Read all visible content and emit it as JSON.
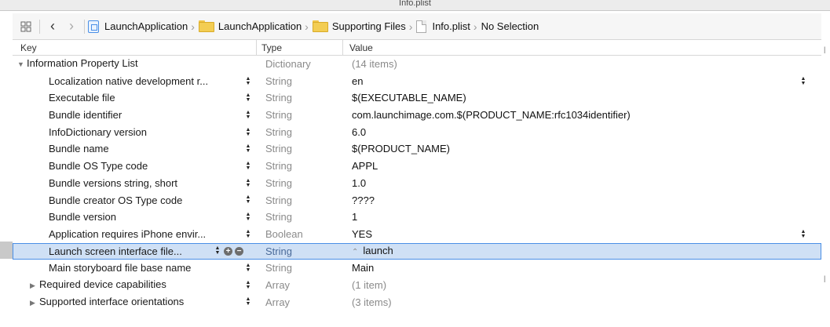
{
  "window": {
    "title": "Info.plist"
  },
  "jumpbar": {
    "crumbs": [
      {
        "label": "LaunchApplication",
        "icon": "project-icon"
      },
      {
        "label": "LaunchApplication",
        "icon": "folder-icon"
      },
      {
        "label": "Supporting Files",
        "icon": "folder-icon"
      },
      {
        "label": "Info.plist",
        "icon": "plist-file-icon"
      },
      {
        "label": "No Selection",
        "icon": ""
      }
    ]
  },
  "table": {
    "headers": {
      "key": "Key",
      "type": "Type",
      "value": "Value"
    },
    "root": {
      "key": "Information Property List",
      "type": "Dictionary",
      "value": "(14 items)"
    },
    "rows": [
      {
        "key": "Localization native development r...",
        "type": "String",
        "value": "en"
      },
      {
        "key": "Executable file",
        "type": "String",
        "value": "$(EXECUTABLE_NAME)"
      },
      {
        "key": "Bundle identifier",
        "type": "String",
        "value": "com.launchimage.com.$(PRODUCT_NAME:rfc1034identifier)"
      },
      {
        "key": "InfoDictionary version",
        "type": "String",
        "value": "6.0"
      },
      {
        "key": "Bundle name",
        "type": "String",
        "value": "$(PRODUCT_NAME)"
      },
      {
        "key": "Bundle OS Type code",
        "type": "String",
        "value": "APPL"
      },
      {
        "key": "Bundle versions string, short",
        "type": "String",
        "value": "1.0"
      },
      {
        "key": "Bundle creator OS Type code",
        "type": "String",
        "value": "????"
      },
      {
        "key": "Bundle version",
        "type": "String",
        "value": "1"
      },
      {
        "key": "Application requires iPhone envir...",
        "type": "Boolean",
        "value": "YES"
      },
      {
        "key": "Launch screen interface file...",
        "type": "String",
        "value": "launch"
      },
      {
        "key": "Main storyboard file base name",
        "type": "String",
        "value": "Main"
      },
      {
        "key": "Required device capabilities",
        "type": "Array",
        "value": "(1 item)"
      },
      {
        "key": "Supported interface orientations",
        "type": "Array",
        "value": "(3 items)"
      }
    ]
  },
  "colors": {
    "selection": "#cfe0f5",
    "selection_border": "#4a8fe6",
    "folder": "#f3cd53"
  }
}
